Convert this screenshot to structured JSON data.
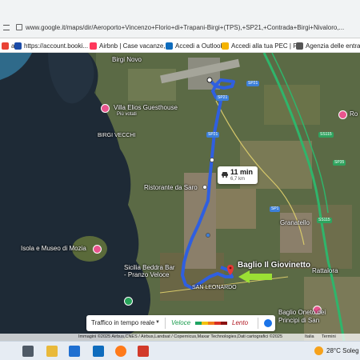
{
  "browser": {
    "url": "www.google.it/maps/dir/Aeroporto+Vincenzo+Florio+di+Trapani-Birgi+(TPS),+SP21,+Contrada+Birgi+Nivaloro,..."
  },
  "bookmarks": [
    {
      "label": "a",
      "color": "#e94235"
    },
    {
      "label": "https://account.booki...",
      "color": "#1a4ba8"
    },
    {
      "label": "Airbnb | Case vacanze,...",
      "color": "#ff385c"
    },
    {
      "label": "Accedi a Outlook",
      "color": "#0f6cbd"
    },
    {
      "label": "Accedi alla tua PEC | P...",
      "color": "#f5b400"
    },
    {
      "label": "Agenzia delle entrate",
      "color": "#555555"
    }
  ],
  "map": {
    "places": {
      "birgi_novo": "Birgi Novo",
      "villa_elios": "Villa Elios Guesthouse",
      "villa_elios_sub": "Più votati",
      "birgi_vecchi": "BIRGI VECCHI",
      "ristorante": "Ristorante da Saro",
      "isola_mozia": "Isola e Museo di Mozia",
      "sicilia_beddra_1": "Sicilia Beddra Bar",
      "sicilia_beddra_2": "- Pranzo Veloce",
      "san_leonardo": "SAN LEONARDO",
      "baglio_giovinetto": "Baglio Il Giovinetto",
      "granatello": "Granatello",
      "rattalora": "Rattalora",
      "baglio_oneto_1": "Baglio Oneto dei",
      "baglio_oneto_2": "Principi di San",
      "ro": "Ro"
    },
    "roads": [
      "SP21",
      "SP21",
      "SP21",
      "SS115",
      "SP35",
      "SP1",
      "SS115"
    ],
    "route": {
      "duration": "11 min",
      "distance": "6,7 km"
    },
    "traffic": {
      "label": "Traffico in tempo reale",
      "fast": "Veloce",
      "slow": "Lento",
      "colors": [
        "#1ea362",
        "#f4c20d",
        "#f07c1c",
        "#d93025",
        "#8a1111"
      ]
    },
    "attribution": "Immagini ©2025 Airbus,CNES / Airbus,Landsat / Copernicus,Maxar Technologies,Dati cartografici ©2025",
    "attribution_links": [
      "Italia",
      "Termini"
    ]
  },
  "taskbar": {
    "temperature": "28°C",
    "weather": "Soleg"
  }
}
